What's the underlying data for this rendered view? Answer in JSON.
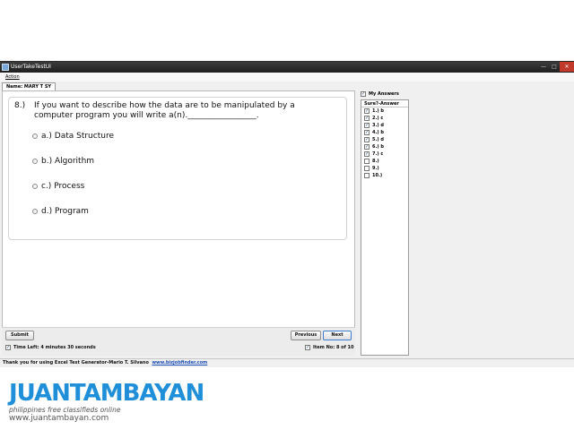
{
  "window": {
    "title": "UserTakeTestUI",
    "menu": {
      "action": "Action"
    },
    "tab": "Name: MARY T SY"
  },
  "question": {
    "number": "8.)",
    "text": "If you want to describe how the data are to be manipulated by a computer program you will write a(n)._________________.",
    "options": [
      {
        "label": "a.)",
        "text": "Data Structure"
      },
      {
        "label": "b.)",
        "text": "Algorithm"
      },
      {
        "label": "c.)",
        "text": "Process"
      },
      {
        "label": "d.)",
        "text": "Program"
      }
    ]
  },
  "controls": {
    "submit": "Submit",
    "previous": "Previous",
    "next": "Next",
    "time_left": "Time Left: 4 minutes 30 seconds",
    "item_no": "Item No: 8 of 10"
  },
  "answers": {
    "header": "My Answers",
    "column": "Sure?-Answer",
    "rows": [
      {
        "text": "1.) b",
        "checked": true
      },
      {
        "text": "2.) c",
        "checked": true
      },
      {
        "text": "3.) d",
        "checked": true
      },
      {
        "text": "4.) b",
        "checked": true
      },
      {
        "text": "5.) d",
        "checked": true
      },
      {
        "text": "6.) b",
        "checked": true
      },
      {
        "text": "7.) c",
        "checked": true
      },
      {
        "text": "8.)",
        "checked": false
      },
      {
        "text": "9.)",
        "checked": false
      },
      {
        "text": "10.)",
        "checked": false
      }
    ]
  },
  "footer": {
    "text": "Thank you for using Excel Test Generator-Mario T. Silvano",
    "link": "www.bizjobfinder.com"
  },
  "watermark": {
    "brand": "JUANTAMBAYAN",
    "tagline": "philippines free classifieds online",
    "url": "www.juantambayan.com"
  }
}
